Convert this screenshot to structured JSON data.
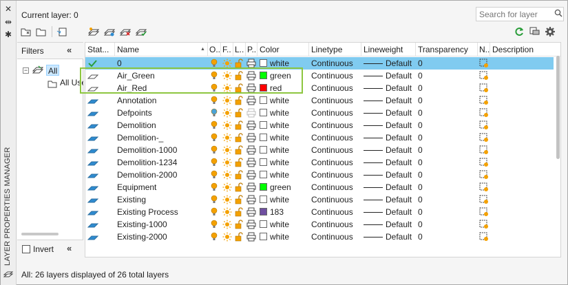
{
  "panel": {
    "vertical_title": "LAYER PROPERTIES MANAGER",
    "current_layer": "Current layer: 0",
    "search_placeholder": "Search for layer",
    "filters_label": "Filters",
    "filter_all": "All",
    "filter_all_used": "All Used Layers",
    "invert_label": "Invert",
    "collapse_glyph": "«",
    "status": "All: 26 layers displayed of 26 total layers"
  },
  "colors": {
    "selected_row": "#80cbf0",
    "highlight_box": "#8dc63f",
    "bulb_on": "#f4a100",
    "bulb_off": "#4aa3d8",
    "status_icon": "#2e8bd0"
  },
  "columns": [
    "Stat...",
    "Name",
    "O..",
    "F..",
    "L..",
    "P..",
    "Color",
    "Linetype",
    "Lineweight",
    "Transparency",
    "N..",
    "Description"
  ],
  "layers": [
    {
      "status": "current",
      "name": "0",
      "on": true,
      "color_name": "white",
      "color_hex": "#ffffff",
      "linetype": "Continuous",
      "lineweight": "Default",
      "transparency": "0",
      "selected": true
    },
    {
      "status": "unused",
      "name": "Air_Green",
      "on": true,
      "color_name": "green",
      "color_hex": "#00ff00",
      "linetype": "Continuous",
      "lineweight": "Default",
      "transparency": "0"
    },
    {
      "status": "unused",
      "name": "Air_Red",
      "on": true,
      "color_name": "red",
      "color_hex": "#ff0000",
      "linetype": "Continuous",
      "lineweight": "Default",
      "transparency": "0"
    },
    {
      "status": "used",
      "name": "Annotation",
      "on": true,
      "color_name": "white",
      "color_hex": "#ffffff",
      "linetype": "Continuous",
      "lineweight": "Default",
      "transparency": "0"
    },
    {
      "status": "used",
      "name": "Defpoints",
      "on": false,
      "color_name": "white",
      "color_hex": "#ffffff",
      "linetype": "Continuous",
      "lineweight": "Default",
      "transparency": "0",
      "noplot": true
    },
    {
      "status": "used",
      "name": "Demolition",
      "on": true,
      "color_name": "white",
      "color_hex": "#ffffff",
      "linetype": "Continuous",
      "lineweight": "Default",
      "transparency": "0"
    },
    {
      "status": "used",
      "name": "Demolition-_",
      "on": true,
      "color_name": "white",
      "color_hex": "#ffffff",
      "linetype": "Continuous",
      "lineweight": "Default",
      "transparency": "0"
    },
    {
      "status": "used",
      "name": "Demolition-1000",
      "on": true,
      "color_name": "white",
      "color_hex": "#ffffff",
      "linetype": "Continuous",
      "lineweight": "Default",
      "transparency": "0"
    },
    {
      "status": "used",
      "name": "Demolition-1234",
      "on": true,
      "color_name": "white",
      "color_hex": "#ffffff",
      "linetype": "Continuous",
      "lineweight": "Default",
      "transparency": "0"
    },
    {
      "status": "used",
      "name": "Demolition-2000",
      "on": true,
      "color_name": "white",
      "color_hex": "#ffffff",
      "linetype": "Continuous",
      "lineweight": "Default",
      "transparency": "0"
    },
    {
      "status": "used",
      "name": "Equipment",
      "on": true,
      "color_name": "green",
      "color_hex": "#00ff00",
      "linetype": "Continuous",
      "lineweight": "Default",
      "transparency": "0"
    },
    {
      "status": "used",
      "name": "Existing",
      "on": true,
      "color_name": "white",
      "color_hex": "#ffffff",
      "linetype": "Continuous",
      "lineweight": "Default",
      "transparency": "0"
    },
    {
      "status": "used",
      "name": "Existing Process",
      "on": true,
      "color_name": "183",
      "color_hex": "#6f4fa0",
      "linetype": "Continuous",
      "lineweight": "Default",
      "transparency": "0"
    },
    {
      "status": "used",
      "name": "Existing-1000",
      "on": true,
      "color_name": "white",
      "color_hex": "#ffffff",
      "linetype": "Continuous",
      "lineweight": "Default",
      "transparency": "0"
    },
    {
      "status": "used",
      "name": "Existing-2000",
      "on": true,
      "color_name": "white",
      "color_hex": "#ffffff",
      "linetype": "Continuous",
      "lineweight": "Default",
      "transparency": "0"
    }
  ]
}
